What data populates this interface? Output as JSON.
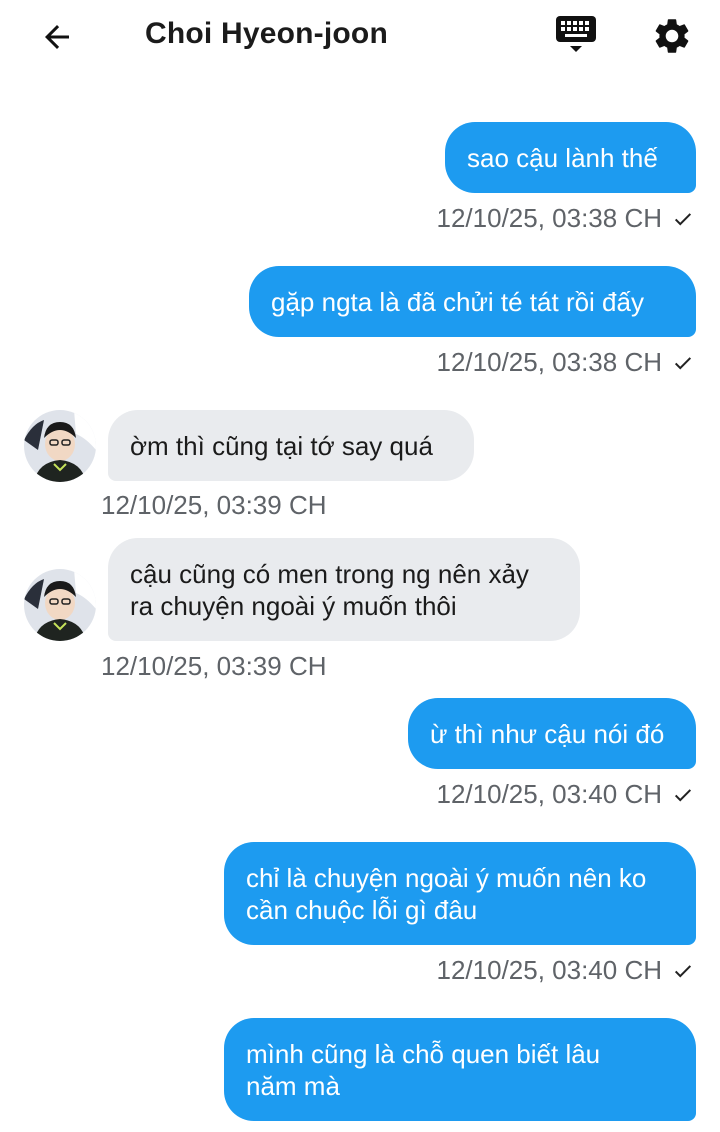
{
  "header": {
    "title": "Choi Hyeon-joon",
    "back_icon": "arrow-left-icon",
    "keyboard_icon": "keyboard-icon",
    "settings_icon": "gear-icon"
  },
  "colors": {
    "outgoing_bubble": "#1d9bf0",
    "incoming_bubble": "#e9ebee",
    "timestamp": "#5f6368"
  },
  "messages": [
    {
      "direction": "out",
      "lines": [
        "sao cậu lành thế"
      ],
      "time": "12/10/25, 03:38 CH",
      "read_tick": true
    },
    {
      "direction": "out",
      "lines": [
        "gặp ngta là đã chửi té tát rồi đấy"
      ],
      "time": "12/10/25, 03:38 CH",
      "read_tick": true
    },
    {
      "direction": "in",
      "lines": [
        "ờm thì cũng tại tớ say quá"
      ],
      "time": "12/10/25, 03:39 CH"
    },
    {
      "direction": "in",
      "lines": [
        "cậu cũng có men trong ng nên xảy",
        "ra chuyện ngoài ý muốn thôi"
      ],
      "time": "12/10/25, 03:39 CH"
    },
    {
      "direction": "out",
      "lines": [
        "ừ thì như cậu nói đó"
      ],
      "time": "12/10/25, 03:40 CH",
      "read_tick": true
    },
    {
      "direction": "out",
      "lines": [
        "chỉ là chuyện ngoài ý muốn nên ko",
        "cần chuộc lỗi gì đâu"
      ],
      "time": "12/10/25, 03:40 CH",
      "read_tick": true
    },
    {
      "direction": "out",
      "lines": [
        "mình cũng là chỗ quen biết lâu",
        "năm mà"
      ]
    }
  ]
}
